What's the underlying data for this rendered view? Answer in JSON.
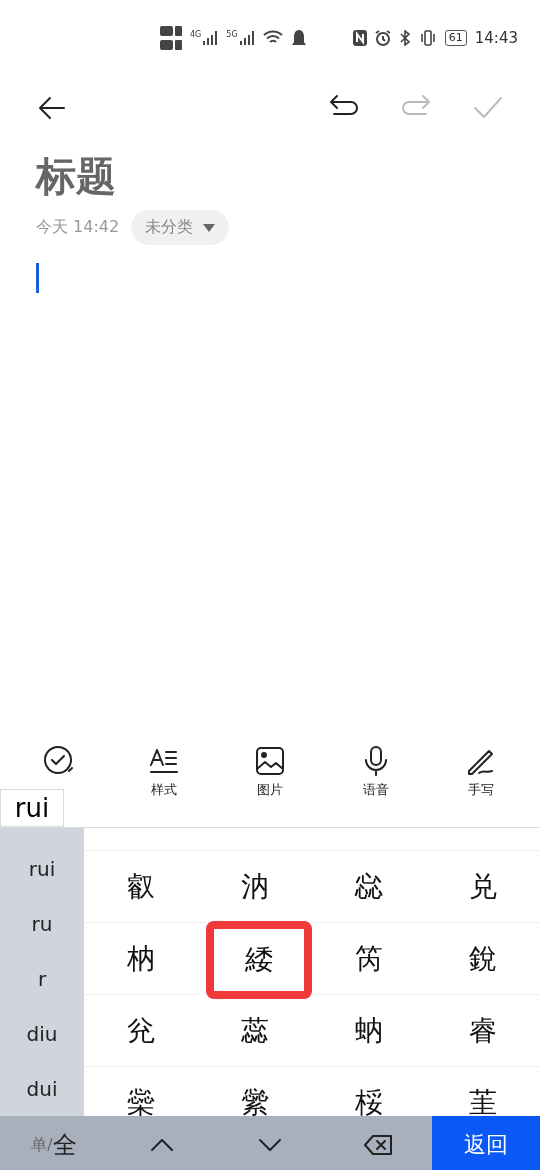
{
  "status_bar": {
    "network_labels": [
      "4G",
      "5G"
    ],
    "battery": "61",
    "time": "14:43"
  },
  "note": {
    "title": "标题",
    "date": "今天 14:42",
    "category": "未分类"
  },
  "toolbar": [
    {
      "kind": "checklist"
    },
    {
      "kind": "style",
      "label": "样式"
    },
    {
      "kind": "image",
      "label": "图片"
    },
    {
      "kind": "voice",
      "label": "语音"
    },
    {
      "kind": "handwrite",
      "label": "手写"
    }
  ],
  "keyboard": {
    "composing": "rui",
    "pinyin_options": [
      "rui",
      "ru",
      "r",
      "diu",
      "dui"
    ],
    "candidates": [
      {
        "text": "叡",
        "selected": false
      },
      {
        "text": "汭",
        "selected": false
      },
      {
        "text": "惢",
        "selected": false
      },
      {
        "text": "兑",
        "selected": false
      },
      {
        "text": "枘",
        "selected": false
      },
      {
        "text": "緌",
        "selected": true
      },
      {
        "text": "笍",
        "selected": false
      },
      {
        "text": "銳",
        "selected": false
      },
      {
        "text": "兊",
        "selected": false
      },
      {
        "text": "蕊",
        "selected": false
      },
      {
        "text": "蚋",
        "selected": false
      },
      {
        "text": "睿",
        "selected": false
      },
      {
        "text": "橤",
        "selected": false
      },
      {
        "text": "繠",
        "selected": false
      },
      {
        "text": "桵",
        "selected": false
      },
      {
        "text": "茥",
        "selected": false
      }
    ],
    "mode_small": "单/",
    "mode_large": "全",
    "return_label": "返回"
  }
}
